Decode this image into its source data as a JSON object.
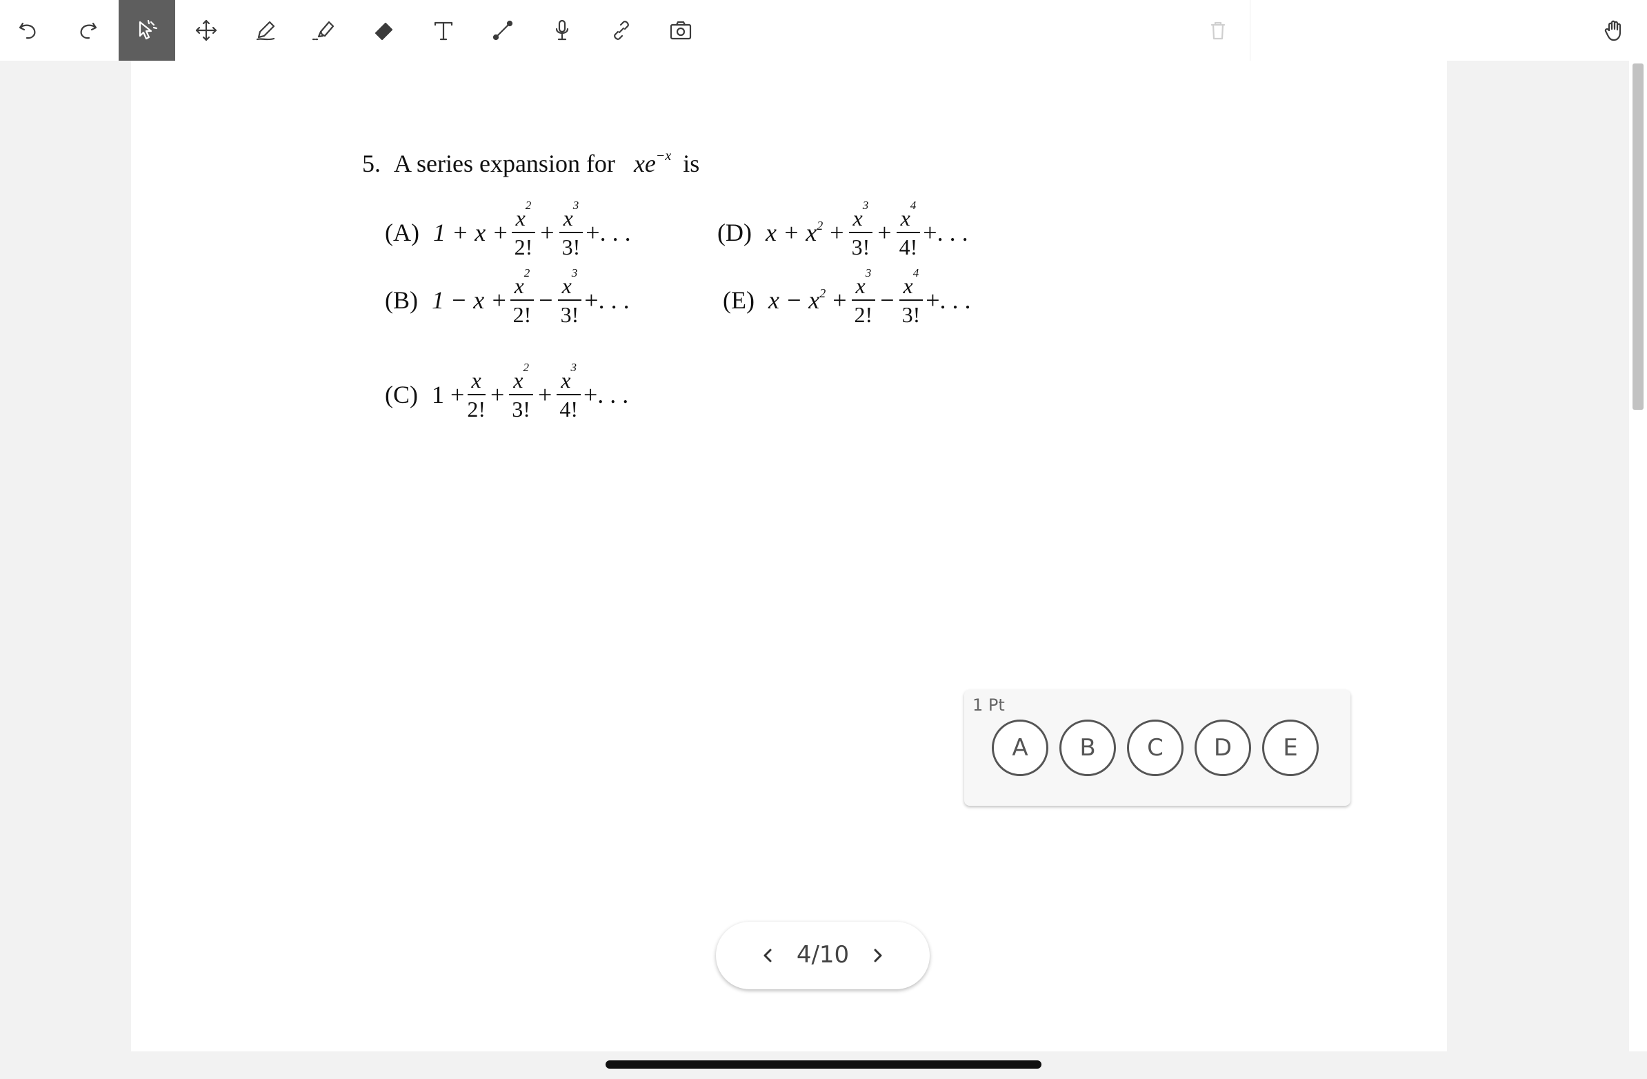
{
  "toolbar": {
    "tools": [
      {
        "name": "undo",
        "icon": "undo-icon"
      },
      {
        "name": "redo",
        "icon": "redo-icon"
      },
      {
        "name": "select",
        "icon": "pointer-icon",
        "active": true
      },
      {
        "name": "move",
        "icon": "move-icon"
      },
      {
        "name": "pen",
        "icon": "pen-icon"
      },
      {
        "name": "highlighter",
        "icon": "highlighter-icon"
      },
      {
        "name": "eraser",
        "icon": "eraser-icon"
      },
      {
        "name": "text",
        "icon": "text-icon"
      },
      {
        "name": "line",
        "icon": "line-icon"
      },
      {
        "name": "microphone",
        "icon": "microphone-icon"
      },
      {
        "name": "link",
        "icon": "link-icon"
      },
      {
        "name": "camera",
        "icon": "camera-icon"
      },
      {
        "name": "delete",
        "icon": "trash-icon",
        "disabled": true
      },
      {
        "name": "hand",
        "icon": "hand-icon"
      }
    ],
    "active_color": "#5e5e5e"
  },
  "question": {
    "number": "5.",
    "stem_text": "A series expansion for",
    "stem_expr_base": "xe",
    "stem_expr_exp": "−x",
    "stem_tail": "is",
    "choices": {
      "a": {
        "label": "(A)",
        "lead": "1 + x +",
        "n1": "x",
        "p1": "2",
        "d1": "2!",
        "op": "+",
        "n2": "x",
        "p2": "3",
        "d2": "3!",
        "tail": "+. . ."
      },
      "b": {
        "label": "(B)",
        "lead": "1 − x +",
        "n1": "x",
        "p1": "2",
        "d1": "2!",
        "op": "−",
        "n2": "x",
        "p2": "3",
        "d2": "3!",
        "tail": "+. . ."
      },
      "c": {
        "label": "(C)",
        "lead": "1 +",
        "n1": "x",
        "d1": "2!",
        "op1": "+",
        "n2": "x",
        "p2": "2",
        "d2": "3!",
        "op2": "+",
        "n3": "x",
        "p3": "3",
        "d3": "4!",
        "tail": "+. . ."
      },
      "d": {
        "label": "(D)",
        "lead_x": "x + x",
        "lead_p": "2",
        "lead_op": "+",
        "n1": "x",
        "p1": "3",
        "d1": "3!",
        "op": "+",
        "n2": "x",
        "p2": "4",
        "d2": "4!",
        "tail": "+. . ."
      },
      "e": {
        "label": "(E)",
        "lead_x": "x − x",
        "lead_p": "2",
        "lead_op": "+",
        "n1": "x",
        "p1": "3",
        "d1": "2!",
        "op": "−",
        "n2": "x",
        "p2": "4",
        "d2": "3!",
        "tail": "+. . ."
      }
    }
  },
  "answer_card": {
    "points": "1 Pt",
    "options": [
      "A",
      "B",
      "C",
      "D",
      "E"
    ]
  },
  "pager": {
    "current": "4/10"
  }
}
